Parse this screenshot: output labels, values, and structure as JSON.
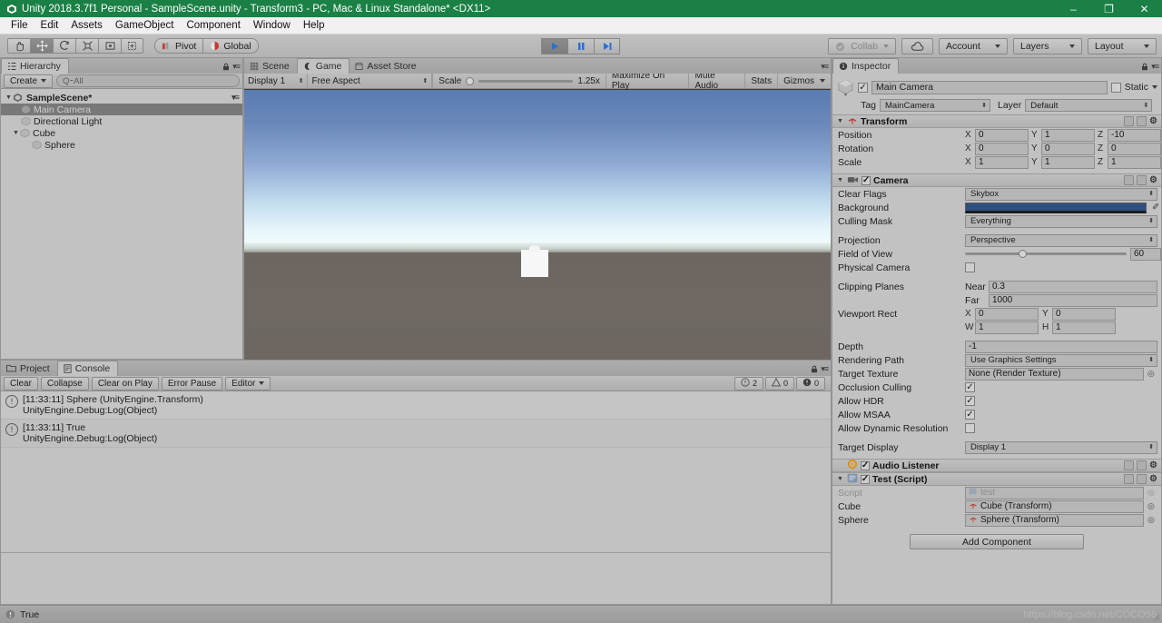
{
  "window": {
    "title": "Unity 2018.3.7f1 Personal - SampleScene.unity - Transform3 - PC, Mac & Linux Standalone* <DX11>",
    "logo_icon": "unity-logo-icon",
    "minimize_label": "–",
    "restore_label": "❐",
    "close_label": "✕"
  },
  "menubar": {
    "items": [
      "File",
      "Edit",
      "Assets",
      "GameObject",
      "Component",
      "Window",
      "Help"
    ]
  },
  "toolbar": {
    "transform_tools": [
      {
        "name": "hand-tool",
        "glyph": "✋",
        "active": false
      },
      {
        "name": "move-tool",
        "glyph": "✥",
        "active": true
      },
      {
        "name": "rotate-tool",
        "glyph": "↻",
        "active": false
      },
      {
        "name": "scale-tool",
        "glyph": "⤢",
        "active": false
      },
      {
        "name": "rect-tool",
        "glyph": "▣",
        "active": false
      },
      {
        "name": "transform-tool",
        "glyph": "❖",
        "active": false
      }
    ],
    "pivot_label": "Pivot",
    "global_label": "Global",
    "play_label": "▶",
    "pause_label": "❙❙",
    "step_label": "▶|",
    "collab_label": "Collab",
    "cloud_label": "cloud-icon",
    "account_label": "Account",
    "layers_label": "Layers",
    "layout_label": "Layout"
  },
  "hierarchy": {
    "tab_label": "Hierarchy",
    "tab_icon": "hierarchy-icon",
    "create_label": "Create",
    "search_placeholder": "Q⁃All",
    "search_value": "",
    "scene_name": "SampleScene*",
    "items": [
      {
        "label": "Main Camera",
        "depth": 2,
        "expandable": false,
        "selected": true
      },
      {
        "label": "Directional Light",
        "depth": 2,
        "expandable": false,
        "selected": false
      },
      {
        "label": "Cube",
        "depth": 1,
        "expandable": true,
        "selected": false
      },
      {
        "label": "Sphere",
        "depth": 3,
        "expandable": false,
        "selected": false
      }
    ]
  },
  "gameview": {
    "tabs": [
      {
        "label": "Scene",
        "icon": "scene-grid-icon",
        "active": false
      },
      {
        "label": "Game",
        "icon": "game-pad-icon",
        "active": true
      },
      {
        "label": "Asset Store",
        "icon": "store-icon",
        "active": false
      }
    ],
    "display_label": "Display 1",
    "aspect_label": "Free Aspect",
    "scale_label": "Scale",
    "scale_value": "1.25x",
    "scale_pct": 2,
    "maximize_label": "Maximize On Play",
    "mute_label": "Mute Audio",
    "stats_label": "Stats",
    "gizmos_label": "Gizmos",
    "sky_top_color": "#5a7cb2",
    "sky_mid_color": "#a8c4e0",
    "sky_horizon_color": "#eef7fb",
    "ground_color": "#6e6761",
    "object_color": "#f6f6f6"
  },
  "console": {
    "tabs": [
      {
        "label": "Project",
        "icon": "folder-icon",
        "active": false
      },
      {
        "label": "Console",
        "icon": "console-icon",
        "active": true
      }
    ],
    "clear_label": "Clear",
    "collapse_label": "Collapse",
    "clear_on_play_label": "Clear on Play",
    "error_pause_label": "Error Pause",
    "editor_label": "Editor",
    "counts": {
      "info": "2",
      "warning": "0",
      "error": "0"
    },
    "logs": [
      {
        "line1": "[11:33:11] Sphere (UnityEngine.Transform)",
        "line2": "UnityEngine.Debug:Log(Object)"
      },
      {
        "line1": "[11:33:11] True",
        "line2": "UnityEngine.Debug:Log(Object)"
      }
    ]
  },
  "inspector": {
    "tab_label": "Inspector",
    "tab_icon": "info-icon",
    "object_name": "Main Camera",
    "object_enabled": true,
    "static_label": "Static",
    "static_checked": false,
    "tag_label": "Tag",
    "tag_value": "MainCamera",
    "layer_label": "Layer",
    "layer_value": "Default",
    "transform": {
      "title": "Transform",
      "icon": "transform-icon",
      "rows": [
        {
          "label": "Position",
          "x": "0",
          "y": "1",
          "z": "-10"
        },
        {
          "label": "Rotation",
          "x": "0",
          "y": "0",
          "z": "0"
        },
        {
          "label": "Scale",
          "x": "1",
          "y": "1",
          "z": "1"
        }
      ]
    },
    "camera": {
      "title": "Camera",
      "icon": "camera-icon",
      "enabled": true,
      "clear_flags_label": "Clear Flags",
      "clear_flags_value": "Skybox",
      "background_label": "Background",
      "background_color": "#2e4f80",
      "culling_mask_label": "Culling Mask",
      "culling_mask_value": "Everything",
      "projection_label": "Projection",
      "projection_value": "Perspective",
      "fov_label": "Field of View",
      "fov_value": "60",
      "fov_pct": 33,
      "physical_camera_label": "Physical Camera",
      "physical_camera_checked": false,
      "clipping_label": "Clipping Planes",
      "near_label": "Near",
      "near_value": "0.3",
      "far_label": "Far",
      "far_value": "1000",
      "viewport_label": "Viewport Rect",
      "viewport_x": "0",
      "viewport_y": "0",
      "viewport_w": "1",
      "viewport_h": "1",
      "depth_label": "Depth",
      "depth_value": "-1",
      "rendering_path_label": "Rendering Path",
      "rendering_path_value": "Use Graphics Settings",
      "target_texture_label": "Target Texture",
      "target_texture_value": "None (Render Texture)",
      "occlusion_label": "Occlusion Culling",
      "occlusion_checked": true,
      "hdr_label": "Allow HDR",
      "hdr_checked": true,
      "msaa_label": "Allow MSAA",
      "msaa_checked": true,
      "dynres_label": "Allow Dynamic Resolution",
      "dynres_checked": false,
      "target_display_label": "Target Display",
      "target_display_value": "Display 1"
    },
    "audio_listener": {
      "title": "Audio Listener",
      "icon": "audio-listener-icon",
      "enabled": true
    },
    "script": {
      "title": "Test (Script)",
      "icon": "script-icon",
      "enabled": true,
      "script_label": "Script",
      "script_value": "test",
      "cube_label": "Cube",
      "cube_value": "Cube (Transform)",
      "sphere_label": "Sphere",
      "sphere_value": "Sphere (Transform)"
    },
    "add_component_label": "Add Component"
  },
  "statusbar": {
    "message": "True",
    "message_icon": "info-icon",
    "watermark": "https://blog.csdn.net/COCO56"
  }
}
